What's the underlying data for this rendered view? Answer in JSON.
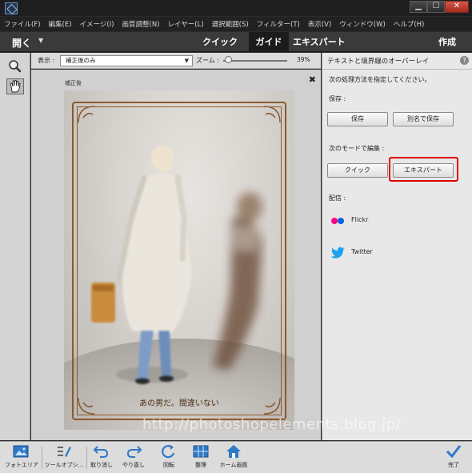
{
  "window": {
    "controls": {
      "minimize": "▁",
      "maximize": "☐",
      "close": "✕"
    }
  },
  "menu": [
    "ファイル(F)",
    "編集(E)",
    "イメージ(I)",
    "画質調整(N)",
    "レイヤー(L)",
    "選択範囲(S)",
    "フィルター(T)",
    "表示(V)",
    "ウィンドウ(W)",
    "ヘルプ(H)"
  ],
  "modebar": {
    "open": "開く",
    "open_arrow": "▼",
    "tabs": [
      "クイック",
      "ガイド",
      "エキスパート"
    ],
    "active_tab": "ガイド",
    "create": "作成"
  },
  "options": {
    "view_label": "表示 :",
    "view_value": "補正後のみ",
    "zoom_label": "ズーム :",
    "zoom_value": "39%",
    "zoom_level_percent": 39
  },
  "canvas": {
    "doc_tab": "補正後",
    "close_glyph": "✖",
    "caption": "あの男だ。間違いない",
    "watermark": "http://photoshopelements.blog.jp/"
  },
  "panel": {
    "title": "テキストと境界線のオーバーレイ",
    "help": "?",
    "instruction": "次の処理方法を指定してください。",
    "save_heading": "保存 :",
    "save_label": "保存",
    "save_as_label": "別名で保存",
    "edit_heading": "次のモードで編集 :",
    "quick_label": "クイック",
    "expert_label": "エキスパート",
    "share_heading": "配信 :",
    "flickr": "Flickr",
    "twitter": "Twitter"
  },
  "bottombar": {
    "photo_bin": "フォトエリア",
    "tool_options": "ツールオプシ...",
    "undo": "取り消し",
    "redo": "やり直し",
    "rotate": "回転",
    "organize": "整理",
    "home": "ホーム画面",
    "done": "完了"
  },
  "colors": {
    "accent_highlight": "#e00000",
    "frame": "#8b5a2b",
    "icon_blue": "#2f79c9",
    "flickr_pink": "#ff0084",
    "flickr_blue": "#0063dc",
    "twitter": "#1da1f2"
  }
}
